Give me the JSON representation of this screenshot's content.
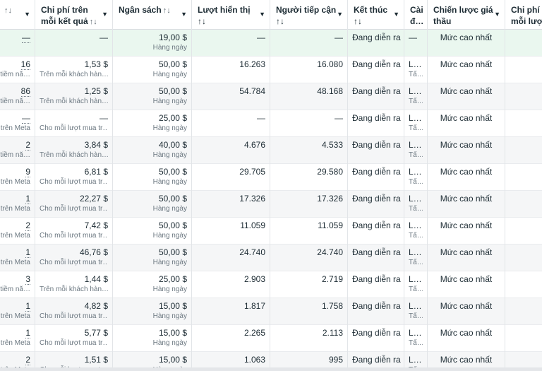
{
  "headers": [
    {
      "label": "",
      "sort": "↑↓",
      "caret": "▼"
    },
    {
      "label": "Chi phí trên\nmỗi kết quả",
      "sort": "↑↓",
      "caret": "▼"
    },
    {
      "label": "Ngân sách",
      "sort": "↑↓",
      "caret": "▼"
    },
    {
      "label": "Lượt hiển thị\n↑↓",
      "sort": "",
      "caret": "▼"
    },
    {
      "label": "Người tiếp cận\n↑↓",
      "sort": "",
      "caret": "▼"
    },
    {
      "label": "Kết thúc\n↑↓",
      "sort": "",
      "caret": "▼"
    },
    {
      "label": "Cài\nđ…",
      "sort": "",
      "caret": ""
    },
    {
      "label": "Chiến lược giá\nthầu",
      "sort": "",
      "caret": "▼"
    },
    {
      "label": "Chi phí t\nmỗi lượt",
      "sort": "",
      "caret": ""
    }
  ],
  "rows": [
    {
      "results": "—",
      "results_sub": "",
      "cpr": "—",
      "cpr_sub": "",
      "budget": "19,00 $",
      "budget_sub": "Hàng ngày",
      "impressions": "—",
      "reach": "—",
      "ends": "Đang diễn ra",
      "attr": "—",
      "attr_sub": "",
      "bid": "Mức cao nhất"
    },
    {
      "results": "16",
      "results_sub": "tiềm nă…",
      "cpr": "1,53 $",
      "cpr_sub": "Trên mỗi khách hàn…",
      "budget": "50,00 $",
      "budget_sub": "Hàng ngày",
      "impressions": "16.263",
      "reach": "16.080",
      "ends": "Đang diễn ra",
      "attr": "L…",
      "attr_sub": "Tấ…",
      "bid": "Mức cao nhất"
    },
    {
      "results": "86",
      "results_sub": "tiềm nă…",
      "cpr": "1,25 $",
      "cpr_sub": "Trên mỗi khách hàn…",
      "budget": "50,00 $",
      "budget_sub": "Hàng ngày",
      "impressions": "54.784",
      "reach": "48.168",
      "ends": "Đang diễn ra",
      "attr": "L…",
      "attr_sub": "Tấ…",
      "bid": "Mức cao nhất"
    },
    {
      "results": "—",
      "results_sub": "trên Meta",
      "cpr": "—",
      "cpr_sub": "Cho mỗi lượt mua tr…",
      "budget": "25,00 $",
      "budget_sub": "Hàng ngày",
      "impressions": "—",
      "reach": "—",
      "ends": "Đang diễn ra",
      "attr": "L…",
      "attr_sub": "Tấ…",
      "bid": "Mức cao nhất"
    },
    {
      "results": "2",
      "results_sub": "tiềm nă…",
      "cpr": "3,84 $",
      "cpr_sub": "Trên mỗi khách hàn…",
      "budget": "40,00 $",
      "budget_sub": "Hàng ngày",
      "impressions": "4.676",
      "reach": "4.533",
      "ends": "Đang diễn ra",
      "attr": "L…",
      "attr_sub": "Tấ…",
      "bid": "Mức cao nhất"
    },
    {
      "results": "9",
      "results_sub": "trên Meta",
      "cpr": "6,81 $",
      "cpr_sub": "Cho mỗi lượt mua tr…",
      "budget": "50,00 $",
      "budget_sub": "Hàng ngày",
      "impressions": "29.705",
      "reach": "29.580",
      "ends": "Đang diễn ra",
      "attr": "L…",
      "attr_sub": "Tấ…",
      "bid": "Mức cao nhất"
    },
    {
      "results": "1",
      "results_sub": "trên Meta",
      "cpr": "22,27 $",
      "cpr_sub": "Cho mỗi lượt mua tr…",
      "budget": "50,00 $",
      "budget_sub": "Hàng ngày",
      "impressions": "17.326",
      "reach": "17.326",
      "ends": "Đang diễn ra",
      "attr": "L…",
      "attr_sub": "Tấ…",
      "bid": "Mức cao nhất"
    },
    {
      "results": "2",
      "results_sub": "trên Meta",
      "cpr": "7,42 $",
      "cpr_sub": "Cho mỗi lượt mua tr…",
      "budget": "50,00 $",
      "budget_sub": "Hàng ngày",
      "impressions": "11.059",
      "reach": "11.059",
      "ends": "Đang diễn ra",
      "attr": "L…",
      "attr_sub": "Tấ…",
      "bid": "Mức cao nhất"
    },
    {
      "results": "1",
      "results_sub": "trên Meta",
      "cpr": "46,76 $",
      "cpr_sub": "Cho mỗi lượt mua tr…",
      "budget": "50,00 $",
      "budget_sub": "Hàng ngày",
      "impressions": "24.740",
      "reach": "24.740",
      "ends": "Đang diễn ra",
      "attr": "L…",
      "attr_sub": "Tấ…",
      "bid": "Mức cao nhất"
    },
    {
      "results": "3",
      "results_sub": "tiềm nă…",
      "cpr": "1,44 $",
      "cpr_sub": "Trên mỗi khách hàn…",
      "budget": "25,00 $",
      "budget_sub": "Hàng ngày",
      "impressions": "2.903",
      "reach": "2.719",
      "ends": "Đang diễn ra",
      "attr": "L…",
      "attr_sub": "Tấ…",
      "bid": "Mức cao nhất"
    },
    {
      "results": "1",
      "results_sub": "trên Meta",
      "cpr": "4,82 $",
      "cpr_sub": "Cho mỗi lượt mua tr…",
      "budget": "15,00 $",
      "budget_sub": "Hàng ngày",
      "impressions": "1.817",
      "reach": "1.758",
      "ends": "Đang diễn ra",
      "attr": "L…",
      "attr_sub": "Tấ…",
      "bid": "Mức cao nhất"
    },
    {
      "results": "1",
      "results_sub": "trên Meta",
      "cpr": "5,77 $",
      "cpr_sub": "Cho mỗi lượt mua tr…",
      "budget": "15,00 $",
      "budget_sub": "Hàng ngày",
      "impressions": "2.265",
      "reach": "2.113",
      "ends": "Đang diễn ra",
      "attr": "L…",
      "attr_sub": "Tấ…",
      "bid": "Mức cao nhất"
    },
    {
      "results": "2",
      "results_sub": "trên Meta",
      "cpr": "1,51 $",
      "cpr_sub": "Cho mỗi lượt mua tr…",
      "budget": "15,00 $",
      "budget_sub": "Hàng ngày",
      "impressions": "1.063",
      "reach": "995",
      "ends": "Đang diễn ra",
      "attr": "L…",
      "attr_sub": "Tấ…",
      "bid": "Mức cao nhất"
    }
  ]
}
